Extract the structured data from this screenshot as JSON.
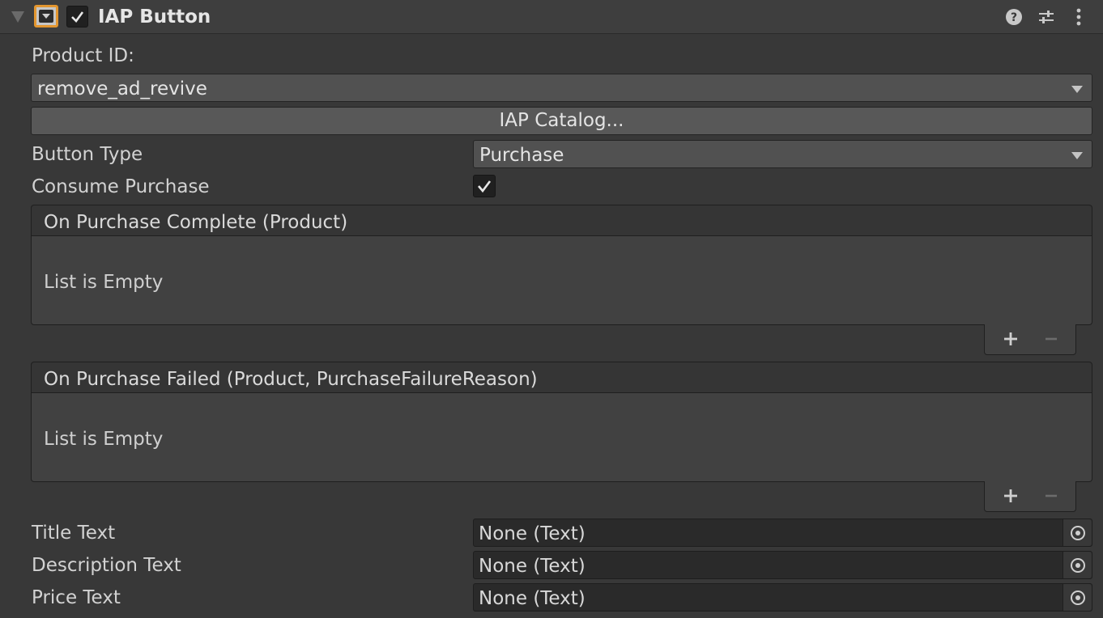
{
  "component": {
    "title": "IAP Button",
    "enabled": true,
    "icons": [
      "foldout-arrow-icon",
      "component-icon",
      "help-icon",
      "preset-icon",
      "more-menu-icon"
    ]
  },
  "fields": {
    "product_id_label": "Product ID:",
    "product_id_value": "remove_ad_revive",
    "catalog_button": "IAP Catalog...",
    "button_type_label": "Button Type",
    "button_type_value": "Purchase",
    "consume_label": "Consume Purchase",
    "consume_checked": true
  },
  "events": [
    {
      "header": "On Purchase Complete (Product)",
      "body": "List is Empty"
    },
    {
      "header": "On Purchase Failed (Product, PurchaseFailureReason)",
      "body": "List is Empty"
    }
  ],
  "text_fields": [
    {
      "label": "Title Text",
      "value": "None (Text)"
    },
    {
      "label": "Description Text",
      "value": "None (Text)"
    },
    {
      "label": "Price Text",
      "value": "None (Text)"
    }
  ],
  "colors": {
    "background": "#383838",
    "header": "#3e3e3e",
    "accent_orange": "#e3962f",
    "field": "#515151",
    "object_field": "#2a2a2a"
  }
}
